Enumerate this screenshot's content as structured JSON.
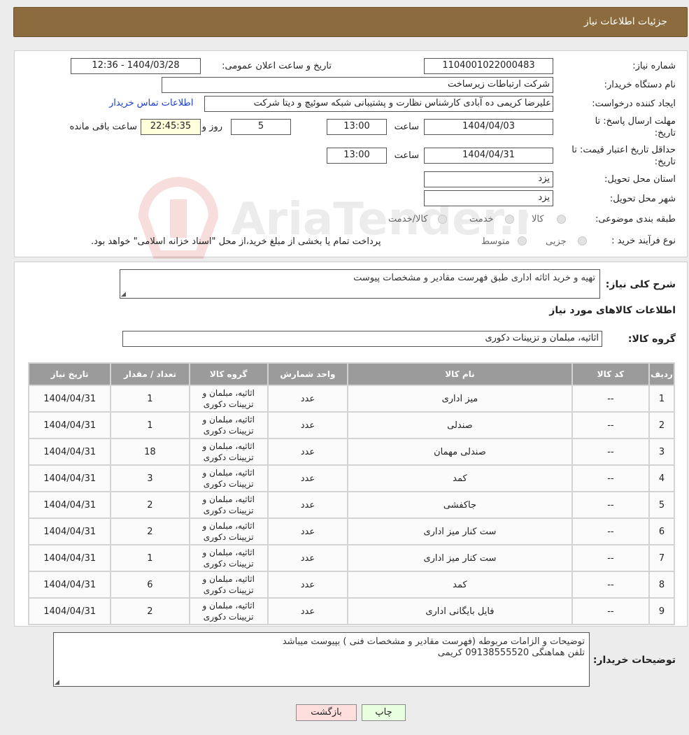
{
  "header": {
    "title": "جزئیات اطلاعات نیاز"
  },
  "info": {
    "need_number_label": "شماره نیاز:",
    "need_number": "1104001022000483",
    "announce_label": "تاریخ و ساعت اعلان عمومی:",
    "announce_value": "1404/03/28 - 12:36",
    "buyer_org_label": "نام دستگاه خریدار:",
    "buyer_org": "شرکت ارتباطات زیرساخت",
    "creator_label": "ایجاد کننده درخواست:",
    "creator": "علیرضا کریمی ده آبادی کارشناس نظارت و پشتیبانی شبکه سوئیچ و دیتا شرکت",
    "contact_link": "اطلاعات تماس خریدار",
    "deadline_label_1": "مهلت ارسال پاسخ: تا",
    "deadline_label_2": "تاریخ:",
    "deadline_date": "1404/04/03",
    "time_label": "ساعت",
    "deadline_time": "13:00",
    "days_value": "5",
    "days_label": "روز و",
    "remaining_time": "22:45:35",
    "remaining_label": "ساعت باقی مانده",
    "validity_label_1": "حداقل تاریخ اعتبار قیمت: تا",
    "validity_label_2": "تاریخ:",
    "validity_date": "1404/04/31",
    "validity_time": "13:00",
    "province_label": "استان محل تحویل:",
    "province": "یزد",
    "city_label": "شهر محل تحویل:",
    "city": "یزد",
    "category_label": "طبقه بندی موضوعی:",
    "category_options": [
      "کالا",
      "خدمت",
      "کالا/خدمت"
    ],
    "process_label": "نوع فرآیند خرید :",
    "process_options": [
      "جزیی",
      "متوسط"
    ],
    "process_note": "پرداخت تمام یا بخشی از مبلغ خرید،از محل \"اسناد خزانه اسلامی\" خواهد بود."
  },
  "description": {
    "label": "شرح کلی نیاز:",
    "value": "تهیه و خرید اثاثه اداری طبق فهرست مقادیر و مشخصات پیوست",
    "goods_title": "اطلاعات کالاهای مورد نیاز",
    "group_label": "گروه کالا:",
    "group_value": "اثاثیه، مبلمان و تزیینات دکوری"
  },
  "table": {
    "headers": [
      "ردیف",
      "کد کالا",
      "نام کالا",
      "واحد شمارش",
      "گروه کالا",
      "تعداد / مقدار",
      "تاریخ نیاز"
    ],
    "rows": [
      {
        "row": "1",
        "code": "--",
        "name": "میز اداری",
        "unit": "عدد",
        "group": "اثاثیه، مبلمان و تزیینات دکوری",
        "qty": "1",
        "date": "1404/04/31"
      },
      {
        "row": "2",
        "code": "--",
        "name": "صندلی",
        "unit": "عدد",
        "group": "اثاثیه، مبلمان و تزیینات دکوری",
        "qty": "1",
        "date": "1404/04/31"
      },
      {
        "row": "3",
        "code": "--",
        "name": "صندلی مهمان",
        "unit": "عدد",
        "group": "اثاثیه، مبلمان و تزیینات دکوری",
        "qty": "18",
        "date": "1404/04/31"
      },
      {
        "row": "4",
        "code": "--",
        "name": "کمد",
        "unit": "عدد",
        "group": "اثاثیه، مبلمان و تزیینات دکوری",
        "qty": "3",
        "date": "1404/04/31"
      },
      {
        "row": "5",
        "code": "--",
        "name": "جاکفشی",
        "unit": "عدد",
        "group": "اثاثیه، مبلمان و تزیینات دکوری",
        "qty": "2",
        "date": "1404/04/31"
      },
      {
        "row": "6",
        "code": "--",
        "name": "ست کنار میز اداری",
        "unit": "عدد",
        "group": "اثاثیه، مبلمان و تزیینات دکوری",
        "qty": "2",
        "date": "1404/04/31"
      },
      {
        "row": "7",
        "code": "--",
        "name": "ست کنار میز اداری",
        "unit": "عدد",
        "group": "اثاثیه، مبلمان و تزیینات دکوری",
        "qty": "1",
        "date": "1404/04/31"
      },
      {
        "row": "8",
        "code": "--",
        "name": "کمد",
        "unit": "عدد",
        "group": "اثاثیه، مبلمان و تزیینات دکوری",
        "qty": "6",
        "date": "1404/04/31"
      },
      {
        "row": "9",
        "code": "--",
        "name": "فایل بایگانی اداری",
        "unit": "عدد",
        "group": "اثاثیه، مبلمان و تزیینات دکوری",
        "qty": "2",
        "date": "1404/04/31"
      }
    ]
  },
  "buyer_notes": {
    "label": "توضیحات خریدار:",
    "value": "توضیحات و الزامات مربوطه (فهرست مقادیر و مشخصات فنی ) بپیوست میباشد\nتلفن هماهنگی 09138555520 کریمی"
  },
  "buttons": {
    "print": "چاپ",
    "back": "بازگشت"
  },
  "watermark": {
    "text": "AriaTender.neT"
  },
  "colors": {
    "header": "#8c6c3e",
    "link": "#1a40c8",
    "table_header": "#9b9b9b",
    "back_button": "#ffdede",
    "print_button": "#e8ffe0"
  }
}
